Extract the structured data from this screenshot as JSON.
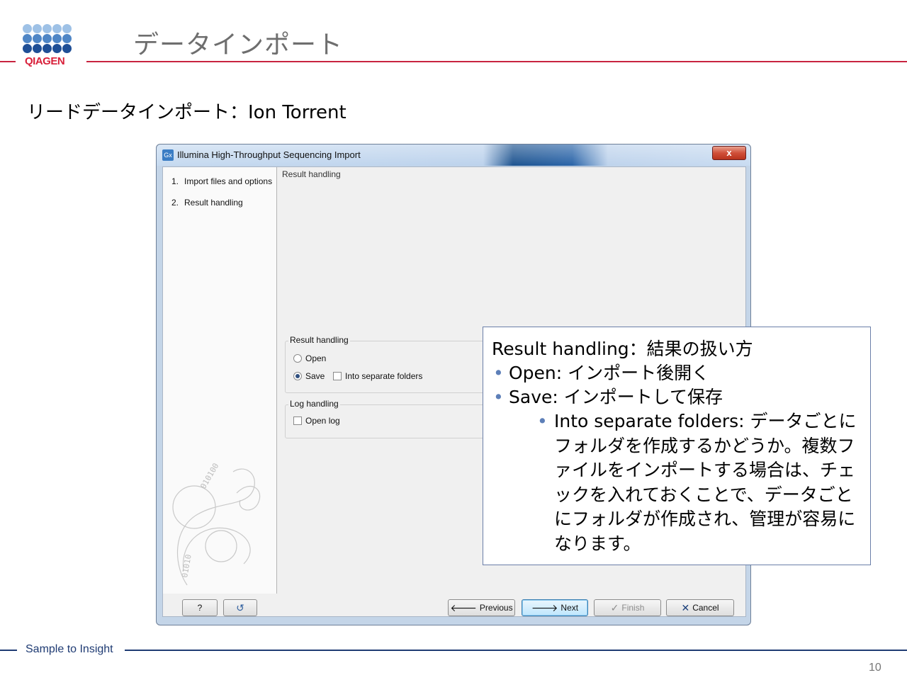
{
  "slide": {
    "title": "データインポート",
    "subtitle": "リードデータインポート：Ion Torrent",
    "tagline": "Sample to Insight",
    "page_number": "10",
    "brand": "QIAGEN"
  },
  "colors": {
    "accent_red": "#c8243f",
    "footer_blue": "#1f3b73",
    "logo_light": "#9ec1e6",
    "logo_mid": "#4f86c6",
    "logo_dark": "#1f4f96"
  },
  "dialog": {
    "app_icon": "Gx",
    "title": "Illumina High-Throughput Sequencing Import",
    "close_label": "x",
    "steps": [
      {
        "num": "1.",
        "label": "Import files and options"
      },
      {
        "num": "2.",
        "label": "Result handling"
      }
    ],
    "panel_title": "Result handling",
    "result_group": {
      "legend": "Result handling",
      "open_label": "Open",
      "save_label": "Save",
      "separate_label": "Into separate folders",
      "selected": "Save"
    },
    "log_group": {
      "legend": "Log handling",
      "open_log_label": "Open log"
    },
    "buttons": {
      "help": "?",
      "reset_icon": "↺",
      "previous": "Previous",
      "next": "Next",
      "finish": "Finish",
      "cancel": "Cancel"
    }
  },
  "callout": {
    "heading": "Result handling：結果の扱い方",
    "items": [
      "Open: インポート後開く",
      "Save: インポートして保存"
    ],
    "sub_item": "Into separate folders: データごとにフォルダを作成するかどうか。複数ファイルをインポートする場合は、チェックを入れておくことで、データごとにフォルダが作成され、管理が容易になります。"
  }
}
